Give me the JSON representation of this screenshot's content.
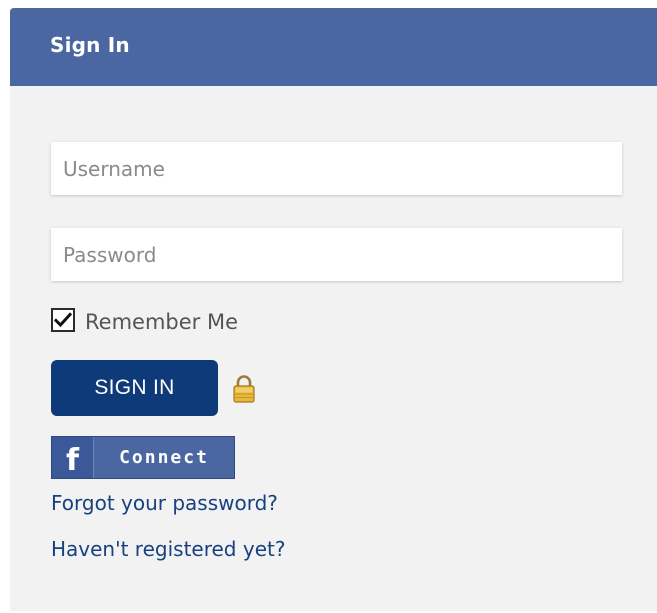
{
  "header": {
    "title": "Sign In"
  },
  "form": {
    "username_placeholder": "Username",
    "username_value": "",
    "password_placeholder": "Password",
    "password_value": "",
    "remember_label": "Remember Me",
    "remember_checked": true,
    "signin_label": "SIGN IN",
    "lock_icon": "lock-icon",
    "facebook_connect_label": "Connect",
    "facebook_icon": "facebook-f-icon"
  },
  "links": {
    "forgot_password": "Forgot your password?",
    "register": "Haven't registered yet?"
  },
  "colors": {
    "header_bg": "#4b67a1",
    "panel_bg": "#f2f2f2",
    "button_bg": "#0f3a7a",
    "link": "#17417f"
  }
}
